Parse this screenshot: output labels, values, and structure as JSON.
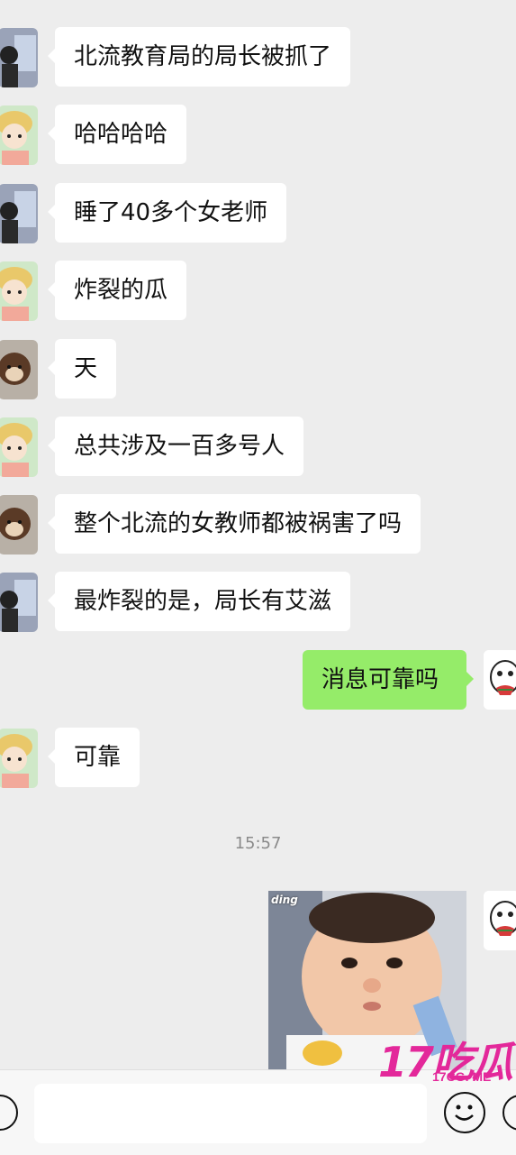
{
  "messages": [
    {
      "text": "北流教育局的局长被抓了",
      "side": "in",
      "avatar": "photo-avatar"
    },
    {
      "text": "哈哈哈哈",
      "side": "in",
      "avatar": "cartoon-girl-avatar"
    },
    {
      "text": "睡了40多个女老师",
      "side": "in",
      "avatar": "photo-avatar"
    },
    {
      "text": "炸裂的瓜",
      "side": "in",
      "avatar": "cartoon-girl-avatar"
    },
    {
      "text": "天",
      "side": "in",
      "avatar": "bear-avatar"
    },
    {
      "text": "总共涉及一百多号人",
      "side": "in",
      "avatar": "cartoon-girl-avatar"
    },
    {
      "text": "整个北流的女教师都被祸害了吗",
      "side": "in",
      "avatar": "bear-avatar"
    },
    {
      "text": "最炸裂的是，局长有艾滋",
      "side": "in",
      "avatar": "photo-avatar"
    },
    {
      "text": "消息可靠吗",
      "side": "out",
      "avatar": "meme-face-avatar"
    },
    {
      "text": "可靠",
      "side": "in",
      "avatar": "cartoon-girl-avatar"
    }
  ],
  "timestamp": "15:57",
  "sticker": {
    "label": "ding",
    "description_icon": "baby-face-sticker"
  },
  "watermark": {
    "big": "17吃瓜",
    "small": "17CG. ME"
  },
  "colors": {
    "background": "#ededed",
    "in_bubble": "#ffffff",
    "out_bubble": "#95ec69",
    "watermark": "#e3289a"
  }
}
